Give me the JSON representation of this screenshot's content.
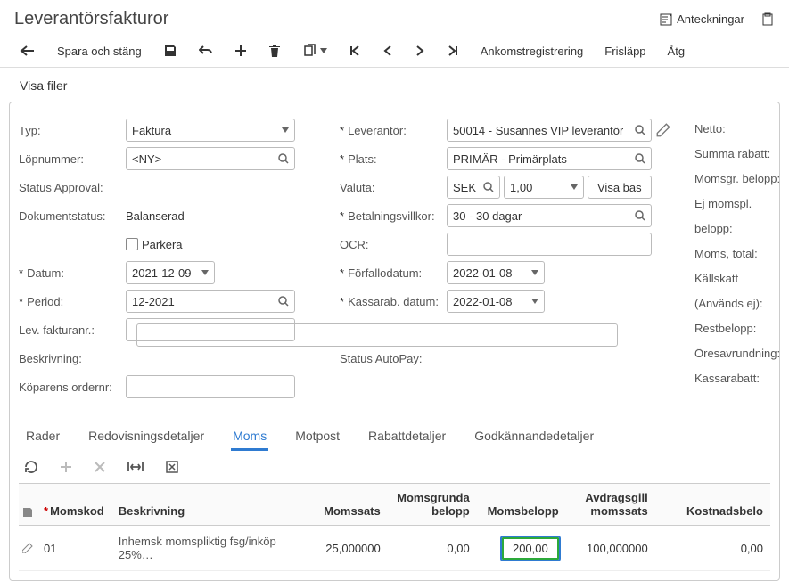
{
  "header": {
    "title": "Leverantörsfakturor",
    "notes": "Anteckningar"
  },
  "toolbar": {
    "save_close": "Spara och stäng",
    "arrival_reg": "Ankomstregistrering",
    "release": "Frisläpp",
    "actions": "Åtg"
  },
  "subbar": {
    "show_files": "Visa filer"
  },
  "form": {
    "typ_label": "Typ:",
    "typ_value": "Faktura",
    "lopnummer_label": "Löpnummer:",
    "lopnummer_value": "<NY>",
    "status_approval_label": "Status Approval:",
    "dokumentstatus_label": "Dokumentstatus:",
    "dokumentstatus_value": "Balanserad",
    "parkera_label": "Parkera",
    "datum_label": "Datum:",
    "datum_value": "2021-12-09",
    "period_label": "Period:",
    "period_value": "12-2021",
    "lev_fakturanr_label": "Lev. fakturanr.:",
    "beskrivning_label": "Beskrivning:",
    "koparens_ordernr_label": "Köparens ordernr:",
    "leverantor_label": "Leverantör:",
    "leverantor_value": "50014 - Susannes VIP leverantör",
    "plats_label": "Plats:",
    "plats_value": "PRIMÄR - Primärplats",
    "valuta_label": "Valuta:",
    "valuta_value": "SEK",
    "valuta_rate": "1,00",
    "visa_bas": "Visa bas",
    "betalningsvillkor_label": "Betalningsvillkor:",
    "betalningsvillkor_value": "30 - 30 dagar",
    "ocr_label": "OCR:",
    "forfallodatum_label": "Förfallodatum:",
    "forfallodatum_value": "2022-01-08",
    "kassarab_datum_label": "Kassarab. datum:",
    "kassarab_datum_value": "2022-01-08",
    "status_autopay_label": "Status AutoPay:"
  },
  "side": {
    "netto": "Netto:",
    "summa_rabatt": "Summa rabatt:",
    "momsgr_belopp": "Momsgr. belopp:",
    "ej_momspl_belopp": "Ej momspl. belopp:",
    "moms_total": "Moms, total:",
    "kallskatt": "Källskatt (Används ej):",
    "restbelopp": "Restbelopp:",
    "oresavrundning": "Öresavrundning:",
    "kassarabatt": "Kassarabatt:"
  },
  "tabs": {
    "rader": "Rader",
    "redovisning": "Redovisningsdetaljer",
    "moms": "Moms",
    "motpost": "Motpost",
    "rabatt": "Rabattdetaljer",
    "godkannande": "Godkännandedetaljer"
  },
  "grid": {
    "headers": {
      "momskod": "Momskod",
      "beskrivning": "Beskrivning",
      "momssats": "Momssats",
      "momsgrunda_belopp": "Momsgrunda belopp",
      "momsbelopp": "Momsbelopp",
      "avdragsgill_momssats": "Avdragsgill momssats",
      "kostnadsbelo": "Kostnadsbelo"
    },
    "row": {
      "momskod": "01",
      "beskrivning": "Inhemsk momspliktig fsg/inköp 25%…",
      "momssats": "25,000000",
      "momsgrunda_belopp": "0,00",
      "momsbelopp": "200,00",
      "avdragsgill_momssats": "100,000000",
      "kostnadsbelo": "0,00"
    }
  }
}
